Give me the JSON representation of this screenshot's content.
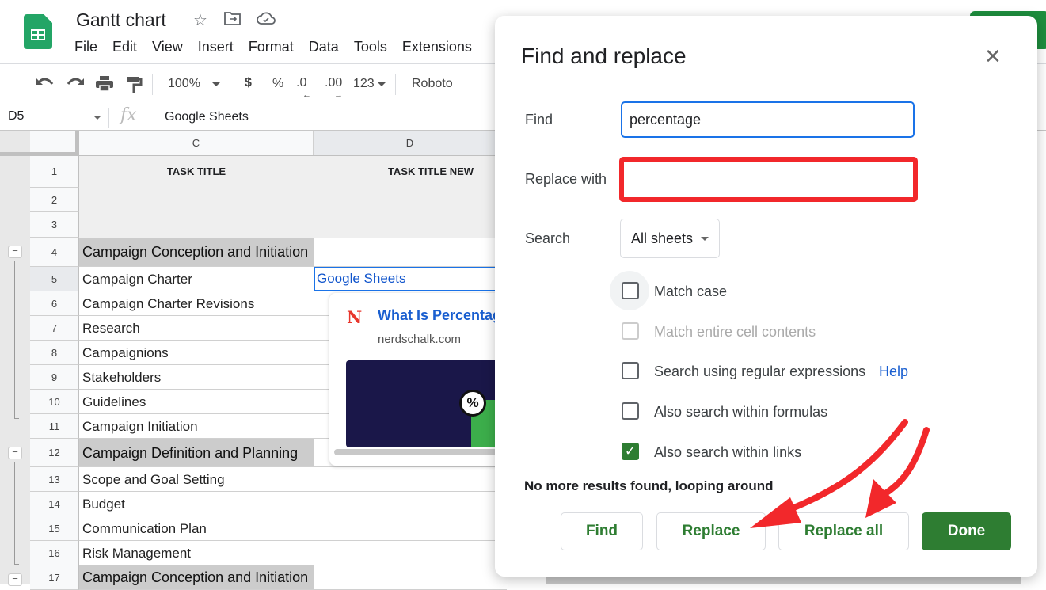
{
  "header": {
    "title": "Gantt chart",
    "menu": [
      "File",
      "Edit",
      "View",
      "Insert",
      "Format",
      "Data",
      "Tools",
      "Extensions"
    ]
  },
  "toolbar": {
    "zoom": "100%",
    "currency": "$",
    "percent": "%",
    "decrease_decimal": ".0",
    "increase_decimal": ".00",
    "more_formats": "123",
    "font": "Roboto"
  },
  "formula_bar": {
    "cell_ref": "D5",
    "fx": "fx",
    "value": "Google Sheets"
  },
  "grid": {
    "columns": [
      "C",
      "D"
    ],
    "header_row": [
      "TASK TITLE",
      "TASK TITLE NEW"
    ],
    "rows": [
      {
        "n": "1",
        "c": ""
      },
      {
        "n": "2",
        "c": ""
      },
      {
        "n": "3",
        "c": ""
      },
      {
        "n": "4",
        "c": "Campaign Conception and Initiation"
      },
      {
        "n": "5",
        "c": "Campaign Charter",
        "d": "Google Sheets"
      },
      {
        "n": "6",
        "c": "Campaign Charter Revisions"
      },
      {
        "n": "7",
        "c": "Research"
      },
      {
        "n": "8",
        "c": "Campaignions"
      },
      {
        "n": "9",
        "c": "Stakeholders"
      },
      {
        "n": "10",
        "c": "Guidelines"
      },
      {
        "n": "11",
        "c": "Campaign Initiation"
      },
      {
        "n": "12",
        "c": "Campaign Definition and Planning"
      },
      {
        "n": "13",
        "c": "Scope and Goal Setting"
      },
      {
        "n": "14",
        "c": "Budget"
      },
      {
        "n": "15",
        "c": "Communication Plan"
      },
      {
        "n": "16",
        "c": "Risk Management"
      },
      {
        "n": "17",
        "c": "Campaign Conception and Initiation"
      }
    ]
  },
  "link_preview": {
    "logo": "N",
    "title": "What Is Percentage",
    "site": "nerdschalk.com",
    "image_badge": "%"
  },
  "dialog": {
    "title": "Find and replace",
    "find_label": "Find",
    "find_value": "percentage",
    "replace_label": "Replace with",
    "replace_value": "",
    "search_label": "Search",
    "search_value": "All sheets",
    "options": [
      {
        "label": "Match case",
        "checked": false,
        "disabled": false
      },
      {
        "label": "Match entire cell contents",
        "checked": false,
        "disabled": true
      },
      {
        "label": "Search using regular expressions",
        "checked": false,
        "disabled": false
      },
      {
        "label": "Also search within formulas",
        "checked": false,
        "disabled": false
      },
      {
        "label": "Also search within links",
        "checked": true,
        "disabled": false
      }
    ],
    "help_link": "Help",
    "status": "No more results found, looping around",
    "buttons": {
      "find": "Find",
      "replace": "Replace",
      "replace_all": "Replace all",
      "done": "Done"
    }
  },
  "colors": {
    "accent_green": "#2e7d32",
    "annotation_red": "#f2282b",
    "focus_blue": "#1a73e8",
    "link_blue": "#1a5fd0"
  }
}
